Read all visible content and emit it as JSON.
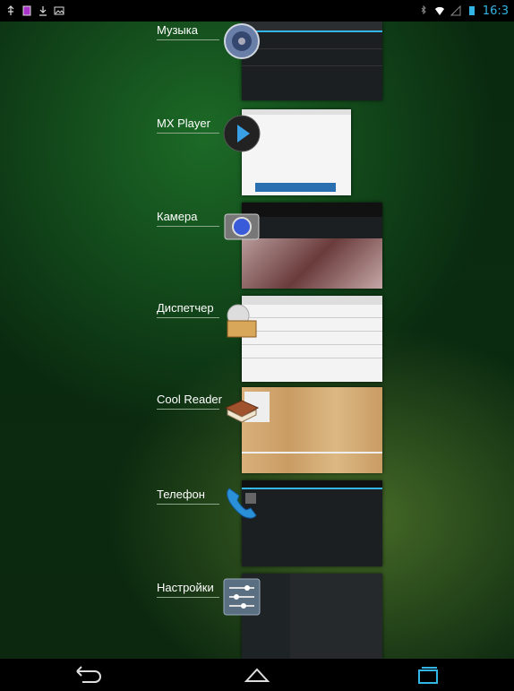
{
  "status_bar": {
    "time": "16:3",
    "left_icons": [
      "usb-icon",
      "sd-card-icon",
      "download-icon",
      "image-icon"
    ],
    "right_icons": [
      "bluetooth-icon",
      "wifi-icon",
      "signal-icon",
      "battery-icon"
    ]
  },
  "recent_apps": [
    {
      "label": "Музыка",
      "icon": "music-icon"
    },
    {
      "label": "MX Player",
      "icon": "play-icon"
    },
    {
      "label": "Камера",
      "icon": "camera-icon"
    },
    {
      "label": "Диспетчер",
      "icon": "file-manager-icon"
    },
    {
      "label": "Cool Reader",
      "icon": "book-icon"
    },
    {
      "label": "Телефон",
      "icon": "phone-icon"
    },
    {
      "label": "Настройки",
      "icon": "settings-icon"
    }
  ],
  "nav_bar": {
    "buttons": [
      "back-icon",
      "home-icon",
      "recent-apps-icon"
    ]
  },
  "colors": {
    "accent": "#33b5e5",
    "status_bg": "#000000"
  }
}
